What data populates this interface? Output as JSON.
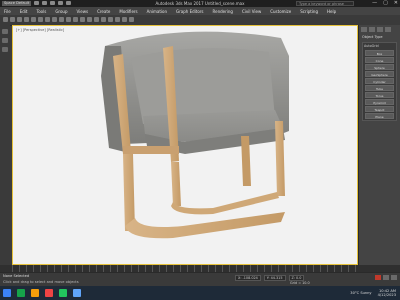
{
  "window": {
    "title": "Autodesk 3ds Max 2017   Untitled_scene.max",
    "workspace": "Space Default",
    "search_placeholder": "Type a keyword or phrase",
    "controls": [
      "—",
      "▢",
      "✕"
    ]
  },
  "menubar": {
    "items": [
      "File",
      "Edit",
      "Tools",
      "Group",
      "Views",
      "Create",
      "Modifiers",
      "Animation",
      "Graph Editors",
      "Rendering",
      "Civil View",
      "Customize",
      "Scripting",
      "Help"
    ]
  },
  "viewport": {
    "label": "[+] [Perspective] [Realistic]"
  },
  "right_panel": {
    "title": "Object Type",
    "group_label": "AutoGrid",
    "buttons": [
      "Box",
      "Cone",
      "Sphere",
      "GeoSphere",
      "Cylinder",
      "Tube",
      "Torus",
      "Pyramid",
      "Teapot",
      "Plane"
    ]
  },
  "status": {
    "selection": "None Selected",
    "prompt": "Click and drag to select and move objects",
    "x": "X: -108.024",
    "y": "Y: 44.315",
    "z": "Z: 0.0",
    "grid": "Grid = 10.0",
    "add_time_tag": "Add Time Tag"
  },
  "taskbar": {
    "weather": "30°C  Sunny",
    "time": "10:42 AM",
    "date": "4/12/2023",
    "app_colors": [
      "#3b82f6",
      "#16a34a",
      "#f59e0b",
      "#ef4444",
      "#22c55e",
      "#60a5fa"
    ]
  }
}
